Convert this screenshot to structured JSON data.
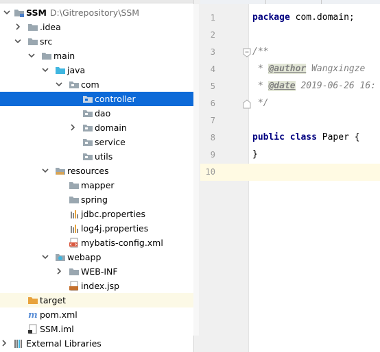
{
  "project_tree": {
    "rows": [
      {
        "label": "SSM",
        "suffix": "D:\\Gitrepository\\SSM",
        "icon": "module-folder-icon",
        "arrow": "down"
      },
      {
        "label": ".idea",
        "icon": "folder-icon",
        "arrow": "right"
      },
      {
        "label": "src",
        "icon": "folder-icon",
        "arrow": "down"
      },
      {
        "label": "main",
        "icon": "folder-icon",
        "arrow": "down"
      },
      {
        "label": "java",
        "icon": "source-folder-icon",
        "arrow": "down"
      },
      {
        "label": "com",
        "icon": "package-icon",
        "arrow": "down"
      },
      {
        "label": "controller",
        "icon": "package-icon",
        "arrow": null
      },
      {
        "label": "dao",
        "icon": "package-icon",
        "arrow": null
      },
      {
        "label": "domain",
        "icon": "package-icon",
        "arrow": "right"
      },
      {
        "label": "service",
        "icon": "package-icon",
        "arrow": null
      },
      {
        "label": "utils",
        "icon": "package-icon",
        "arrow": null
      },
      {
        "label": "resources",
        "icon": "resources-folder-icon",
        "arrow": "down"
      },
      {
        "label": "mapper",
        "icon": "folder-icon",
        "arrow": null
      },
      {
        "label": "spring",
        "icon": "folder-icon",
        "arrow": null
      },
      {
        "label": "jdbc.properties",
        "icon": "properties-file-icon",
        "arrow": null
      },
      {
        "label": "log4j.properties",
        "icon": "properties-file-icon",
        "arrow": null
      },
      {
        "label": "mybatis-config.xml",
        "icon": "xml-file-icon",
        "arrow": null
      },
      {
        "label": "webapp",
        "icon": "web-folder-icon",
        "arrow": "down"
      },
      {
        "label": "WEB-INF",
        "icon": "folder-icon",
        "arrow": "right"
      },
      {
        "label": "index.jsp",
        "icon": "jsp-file-icon",
        "arrow": null
      },
      {
        "label": "target",
        "icon": "excluded-folder-icon",
        "arrow": null
      },
      {
        "label": "pom.xml",
        "icon": "maven-file-icon",
        "arrow": null
      },
      {
        "label": "SSM.iml",
        "icon": "iml-file-icon",
        "arrow": null
      },
      {
        "label": "External Libraries",
        "icon": "libraries-icon",
        "arrow": "right"
      }
    ],
    "selected": "controller",
    "excluded": "target"
  },
  "editor": {
    "line_numbers": [
      "1",
      "2",
      "3",
      "4",
      "5",
      "6",
      "7",
      "8",
      "9",
      "10"
    ],
    "current_line": "10",
    "code": {
      "l1_kw": "package",
      "l1_rest": " com.domain;",
      "l3": "/**",
      "l4_star": " * ",
      "l4_tag": "@author",
      "l4_val": " Wangxingze",
      "l5_star": " * ",
      "l5_tag": "@date",
      "l5_val": " 2019-06-26 16:",
      "l6": " */",
      "l8_kw1": "public",
      "l8_kw2": "class",
      "l8_name": "Paper",
      "l8_brace": " {",
      "l9": "}"
    }
  },
  "colors": {
    "selection": "#0d6ad8",
    "excluded_bg": "#fcf9e6",
    "keyword": "#000080",
    "comment": "#808080",
    "gutter": "#f0f0f0",
    "current_line": "#fffae3"
  }
}
